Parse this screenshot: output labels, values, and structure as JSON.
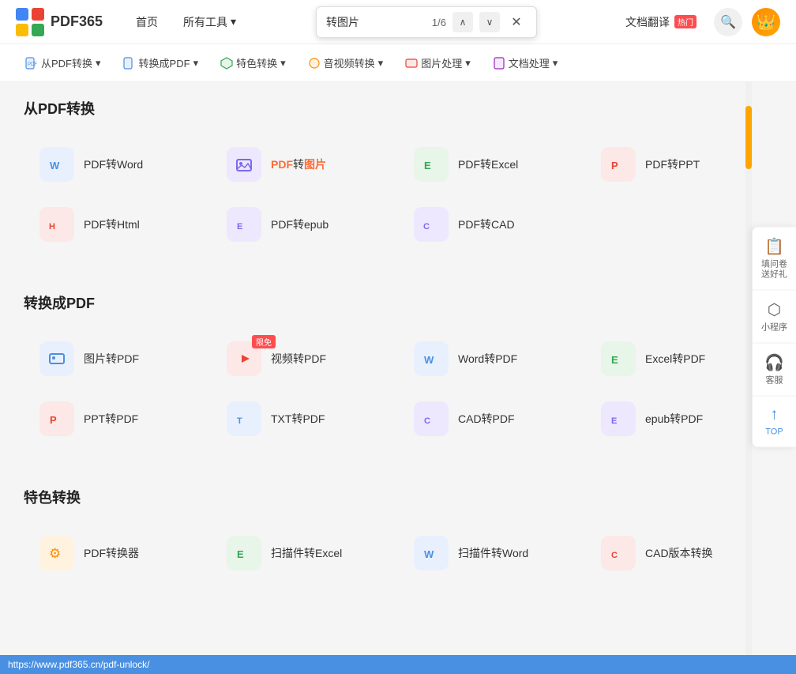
{
  "app": {
    "title": "PDF365",
    "logo_text": "PDF365"
  },
  "top_nav": {
    "links": [
      {
        "id": "home",
        "label": "首页"
      },
      {
        "id": "all_tools",
        "label": "所有工具",
        "has_arrow": true
      }
    ],
    "translate_label": "文档翻译",
    "translate_badge": "热门",
    "search_popup": {
      "text": "转图片",
      "count": "1/6"
    }
  },
  "toolbar": {
    "items": [
      {
        "id": "from_pdf",
        "label": "从PDF转换",
        "icon": "📄"
      },
      {
        "id": "to_pdf",
        "label": "转换成PDF",
        "icon": "📋"
      },
      {
        "id": "special",
        "label": "特色转换",
        "icon": "🛡️"
      },
      {
        "id": "av",
        "label": "音视频转换",
        "icon": "🎵"
      },
      {
        "id": "image",
        "label": "图片处理",
        "icon": "🖼️"
      },
      {
        "id": "doc",
        "label": "文档处理",
        "icon": "📝"
      }
    ]
  },
  "sections": [
    {
      "id": "from_pdf",
      "title": "从PDF转换",
      "tools": [
        {
          "id": "pdf_word",
          "label": "PDF转Word",
          "icon_color": "#4a90e2",
          "icon_bg": "#e8f0fe",
          "icon": "W"
        },
        {
          "id": "pdf_image",
          "label": "PDF转图片",
          "icon_color": "#7b68ee",
          "icon_bg": "#ede8fe",
          "icon": "🖼",
          "highlight": "转图片"
        },
        {
          "id": "pdf_excel",
          "label": "PDF转Excel",
          "icon_color": "#34a853",
          "icon_bg": "#e8f5e9",
          "icon": "E"
        },
        {
          "id": "pdf_ppt",
          "label": "PDF转PPT",
          "icon_color": "#ea4335",
          "icon_bg": "#fce8e6",
          "icon": "P"
        },
        {
          "id": "pdf_html",
          "label": "PDF转Html",
          "icon_color": "#ea4335",
          "icon_bg": "#fce8e6",
          "icon": "H"
        },
        {
          "id": "pdf_epub",
          "label": "PDF转epub",
          "icon_color": "#7b68ee",
          "icon_bg": "#ede8fe",
          "icon": "E"
        },
        {
          "id": "pdf_cad",
          "label": "PDF转CAD",
          "icon_color": "#7b68ee",
          "icon_bg": "#ede8fe",
          "icon": "C"
        }
      ]
    },
    {
      "id": "to_pdf",
      "title": "转换成PDF",
      "tools": [
        {
          "id": "img_pdf",
          "label": "图片转PDF",
          "icon_color": "#4a90e2",
          "icon_bg": "#e8f0fe",
          "icon": "🖼"
        },
        {
          "id": "vid_pdf",
          "label": "视频转PDF",
          "icon_color": "#ea4335",
          "icon_bg": "#fce8e6",
          "icon": "▶",
          "badge": "限免"
        },
        {
          "id": "word_pdf",
          "label": "Word转PDF",
          "icon_color": "#4a90e2",
          "icon_bg": "#e8f0fe",
          "icon": "W"
        },
        {
          "id": "excel_pdf",
          "label": "Excel转PDF",
          "icon_color": "#34a853",
          "icon_bg": "#e8f5e9",
          "icon": "E"
        },
        {
          "id": "ppt_pdf",
          "label": "PPT转PDF",
          "icon_color": "#ea4335",
          "icon_bg": "#fce8e6",
          "icon": "P"
        },
        {
          "id": "txt_pdf",
          "label": "TXT转PDF",
          "icon_color": "#4a90e2",
          "icon_bg": "#e8f0fe",
          "icon": "T"
        },
        {
          "id": "cad_pdf",
          "label": "CAD转PDF",
          "icon_color": "#7b68ee",
          "icon_bg": "#ede8fe",
          "icon": "C"
        },
        {
          "id": "epub_pdf",
          "label": "epub转PDF",
          "icon_color": "#7b68ee",
          "icon_bg": "#ede8fe",
          "icon": "E"
        }
      ]
    },
    {
      "id": "special",
      "title": "特色转换",
      "tools": [
        {
          "id": "pdf_converter",
          "label": "PDF转换器",
          "icon_color": "#ff8c00",
          "icon_bg": "#fff3e0",
          "icon": "⚙"
        },
        {
          "id": "scan_excel",
          "label": "扫描件转Excel",
          "icon_color": "#34a853",
          "icon_bg": "#e8f5e9",
          "icon": "E"
        },
        {
          "id": "scan_word",
          "label": "扫描件转Word",
          "icon_color": "#4a90e2",
          "icon_bg": "#e8f0fe",
          "icon": "W"
        },
        {
          "id": "cad_version",
          "label": "CAD版本转换",
          "icon_color": "#ea4335",
          "icon_bg": "#fce8e6",
          "icon": "C"
        }
      ]
    }
  ],
  "right_panel": {
    "items": [
      {
        "id": "survey",
        "label": "填问卷\n送好礼",
        "icon": "📋"
      },
      {
        "id": "miniapp",
        "label": "小程序",
        "icon": "⬡"
      },
      {
        "id": "service",
        "label": "客服",
        "icon": "🎧"
      },
      {
        "id": "top",
        "label": "TOP",
        "icon": "↑"
      }
    ]
  },
  "status_bar": {
    "url": "https://www.pdf365.cn/pdf-unlock/"
  }
}
